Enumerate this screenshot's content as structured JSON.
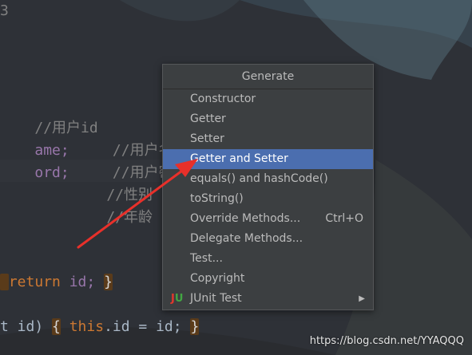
{
  "editor": {
    "lines": [
      {
        "pre": "",
        "code": "//用户id"
      },
      {
        "code": "ame;",
        "comment": "//用户名"
      },
      {
        "code": "ord;",
        "comment": "//用户密码"
      },
      {
        "comment": "//性别"
      },
      {
        "comment": "//年龄"
      }
    ],
    "return_kw": "return",
    "return_field": "id;",
    "brace_close": "}",
    "setter_tail": "t id)",
    "brace_open": "{",
    "this_kw": "this",
    "setter_body": ".id = id;"
  },
  "popup": {
    "title": "Generate",
    "items": [
      {
        "label": "Constructor"
      },
      {
        "label": "Getter"
      },
      {
        "label": "Setter"
      },
      {
        "label": "Getter and Setter",
        "selected": true
      },
      {
        "label": "equals() and hashCode()"
      },
      {
        "label": "toString()"
      },
      {
        "label": "Override Methods...",
        "shortcut": "Ctrl+O"
      },
      {
        "label": "Delegate Methods..."
      },
      {
        "label": "Test..."
      },
      {
        "label": "Copyright"
      },
      {
        "label": "JUnit Test",
        "icon": "junit-icon",
        "submenu_arrow": "▶"
      }
    ]
  },
  "watermark": "https://blog.csdn.net/YYAQQQ",
  "colors": {
    "selection": "#4b6eaf",
    "arrow": "#e8302a",
    "popup_bg": "#3c3f41"
  }
}
